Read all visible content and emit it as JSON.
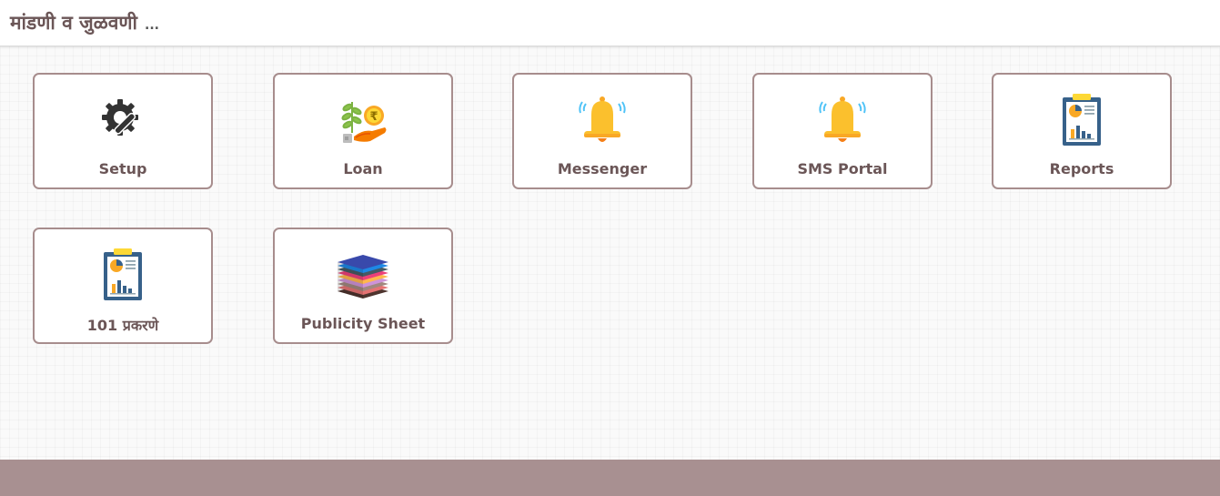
{
  "header": {
    "title": "मांडणी व जुळवणी",
    "ellipsis": "..."
  },
  "tiles": [
    {
      "label": "Setup",
      "icon": "gear-wrench-icon"
    },
    {
      "label": "Loan",
      "icon": "loan-rupee-hand-icon"
    },
    {
      "label": "Messenger",
      "icon": "bell-icon"
    },
    {
      "label": "SMS Portal",
      "icon": "bell-icon"
    },
    {
      "label": "Reports",
      "icon": "clipboard-report-icon"
    },
    {
      "label": "101 प्रकरणे",
      "icon": "clipboard-report-icon"
    },
    {
      "label": "Publicity Sheet",
      "icon": "paper-stack-icon"
    }
  ],
  "colors": {
    "tile_border": "#a78d8d",
    "label_text": "#6b5657",
    "footer": "#a89091",
    "bell": "#fbc02d"
  }
}
